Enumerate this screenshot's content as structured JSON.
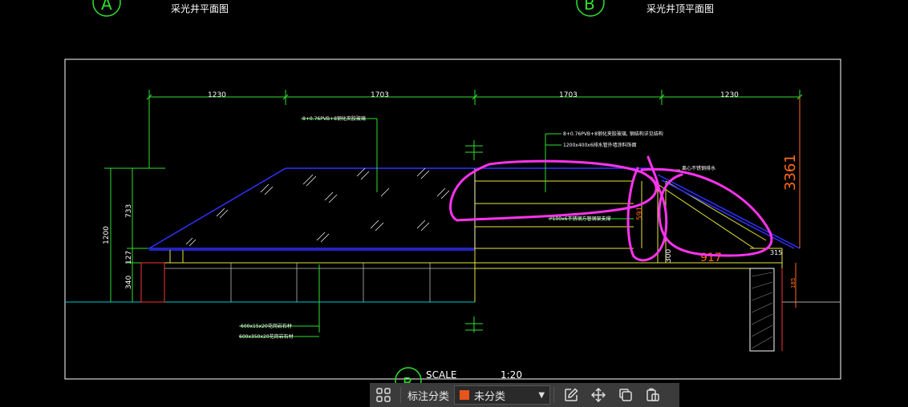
{
  "drawing": {
    "section_a_marker": "A",
    "section_a_title": "采光井平面图",
    "section_b_marker": "B",
    "section_b_title": "采光井顶平面图",
    "section_c_marker": "B",
    "scale_label": "SCALE",
    "scale_value": "1:20",
    "dims_top": [
      "1230",
      "1703",
      "1703",
      "1230"
    ],
    "dim_left_total": "1200",
    "dim_left_parts": [
      "733",
      "127",
      "340"
    ],
    "dim_right_total": "3361",
    "dim_mid_vertical": "591",
    "dim_300": "300",
    "dim_917": "917",
    "dim_315": "315",
    "dim_185": "185",
    "annotations": {
      "glass_top": "8+0.76PVB+8钢化夹胶玻璃",
      "glass_right_1": "8+0.76PVB+8钢化夹胶玻璃, 钢结构详见结构",
      "glass_right_2": "1200x400x6排水管外墙涂料饰面",
      "steel_frame": "P100x6不锈钢方管钢架支撑",
      "drain_label": "离心不锈钢排水",
      "stone_1": "600x15x20花岗岩石材",
      "stone_2": "600x350x20花岗岩石材"
    }
  },
  "toolbar": {
    "grid_icon": "grid-icon",
    "label": "标注分类",
    "category_value": "未分类",
    "category_color": "#e8541b",
    "icons": [
      "edit-icon",
      "move-icon",
      "copy-icon",
      "paste-icon"
    ]
  }
}
